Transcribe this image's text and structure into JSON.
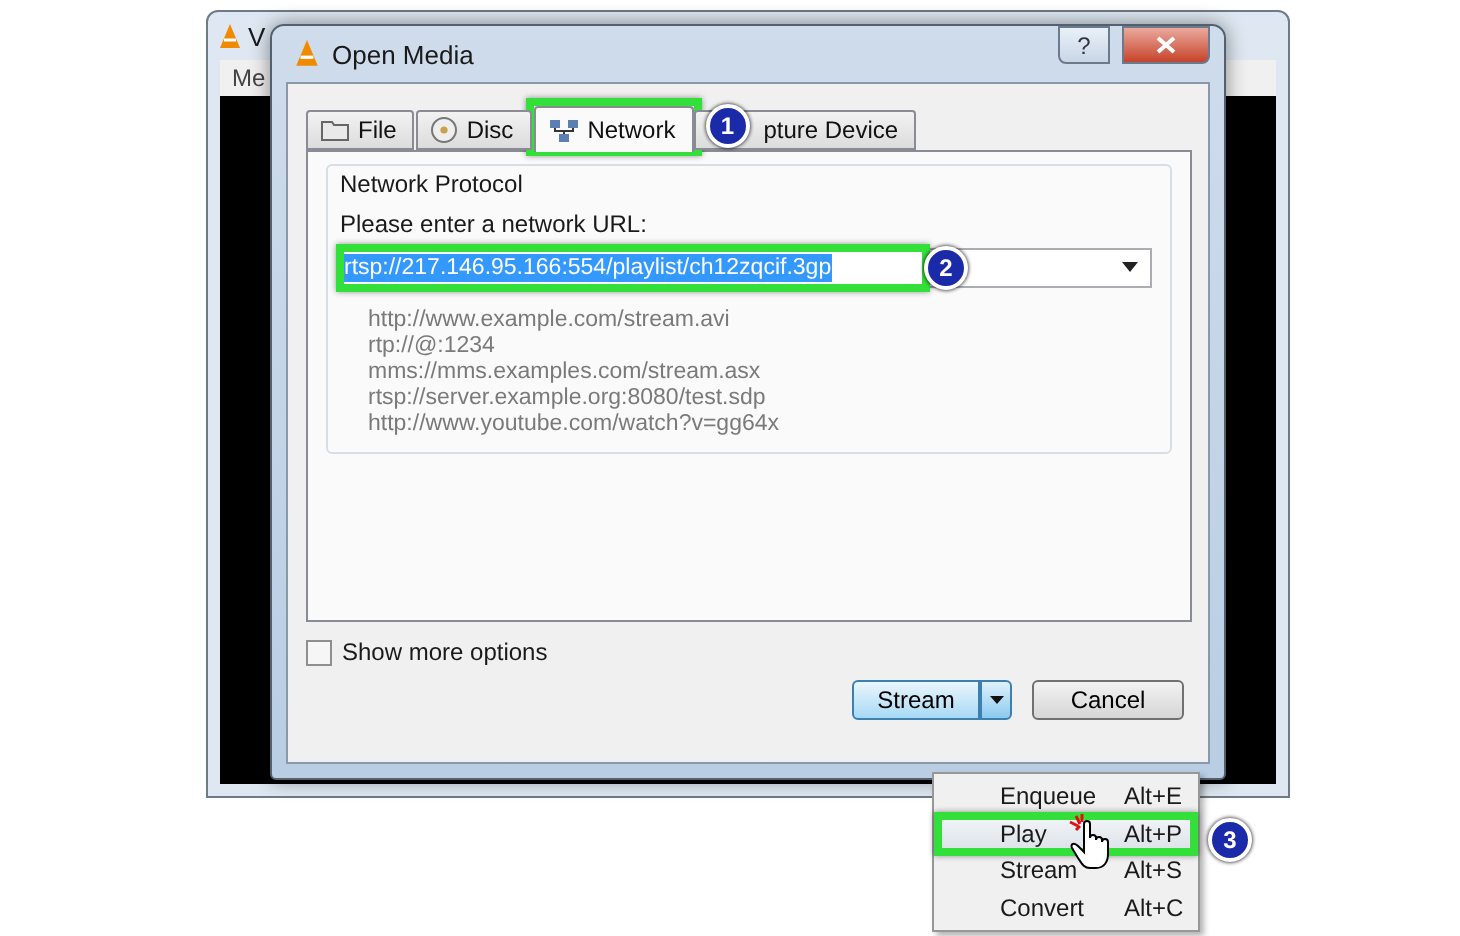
{
  "background_window": {
    "title": "V",
    "menu": [
      "Me"
    ]
  },
  "dialog": {
    "title": "Open Media",
    "help": "?",
    "tabs": [
      {
        "label": "File",
        "selected": false
      },
      {
        "label": "Disc",
        "selected": false
      },
      {
        "label": "Network",
        "selected": true,
        "callout": "1"
      },
      {
        "label": "pture Device",
        "selected": false
      }
    ],
    "group_title": "Network Protocol",
    "url_label": "Please enter a network URL:",
    "url": {
      "value": "rtsp://217.146.95.166:554/playlist/ch12zqcif.3gp",
      "text_selected": true,
      "callout": "2"
    },
    "examples": [
      "http://www.example.com/stream.avi",
      "rtp://@:1234",
      "mms://mms.examples.com/stream.asx",
      "rtsp://server.example.org:8080/test.sdp",
      "http://www.youtube.com/watch?v=gg64x"
    ],
    "show_more_options": {
      "label": "Show more options",
      "checked": false
    },
    "stream_button": "Stream",
    "cancel_button": "Cancel"
  },
  "menu": [
    {
      "label": "Enqueue",
      "shortcut": "Alt+E",
      "selected": false
    },
    {
      "label": "Play",
      "shortcut": "Alt+P",
      "selected": true,
      "callout": "3"
    },
    {
      "label": "Stream",
      "shortcut": "Alt+S",
      "selected": false
    },
    {
      "label": "Convert",
      "shortcut": "Alt+C",
      "selected": false
    }
  ]
}
